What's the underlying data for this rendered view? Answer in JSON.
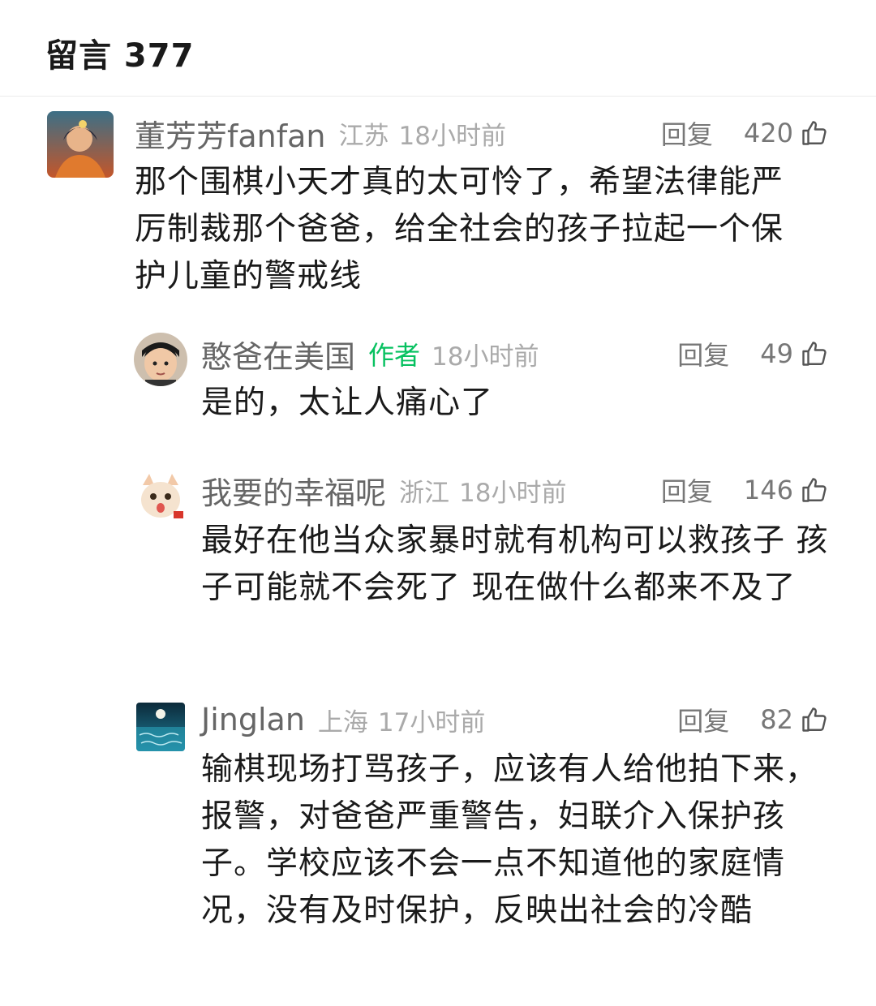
{
  "header": {
    "title": "留言 377"
  },
  "comments": [
    {
      "name": "董芳芳fanfan",
      "author_tag": "",
      "location": "江苏",
      "time": "18小时前",
      "reply_label": "回复",
      "likes": "420",
      "text": "那个围棋小天才真的太可怜了，希望法律能严厉制裁那个爸爸，给全社会的孩子拉起一个保护儿童的警戒线"
    },
    {
      "name": "憨爸在美国",
      "author_tag": "作者",
      "location": "",
      "time": "18小时前",
      "reply_label": "回复",
      "likes": "49",
      "text": "是的，太让人痛心了"
    },
    {
      "name": "我要的幸福呢",
      "author_tag": "",
      "location": "浙江",
      "time": "18小时前",
      "reply_label": "回复",
      "likes": "146",
      "text": "最好在他当众家暴时就有机构可以救孩子 孩子可能就不会死了 现在做什么都来不及了"
    },
    {
      "name": "Jinglan",
      "author_tag": "",
      "location": "上海",
      "time": "17小时前",
      "reply_label": "回复",
      "likes": "82",
      "text": "输棋现场打骂孩子，应该有人给他拍下来，报警，对爸爸严重警告，妇联介入保护孩子。学校应该不会一点不知道他的家庭情况，没有及时保护，反映出社会的冷酷"
    }
  ],
  "colors": {
    "author_green": "#07c160",
    "meta_gray": "#aaaaaa",
    "name_gray": "#666666"
  }
}
